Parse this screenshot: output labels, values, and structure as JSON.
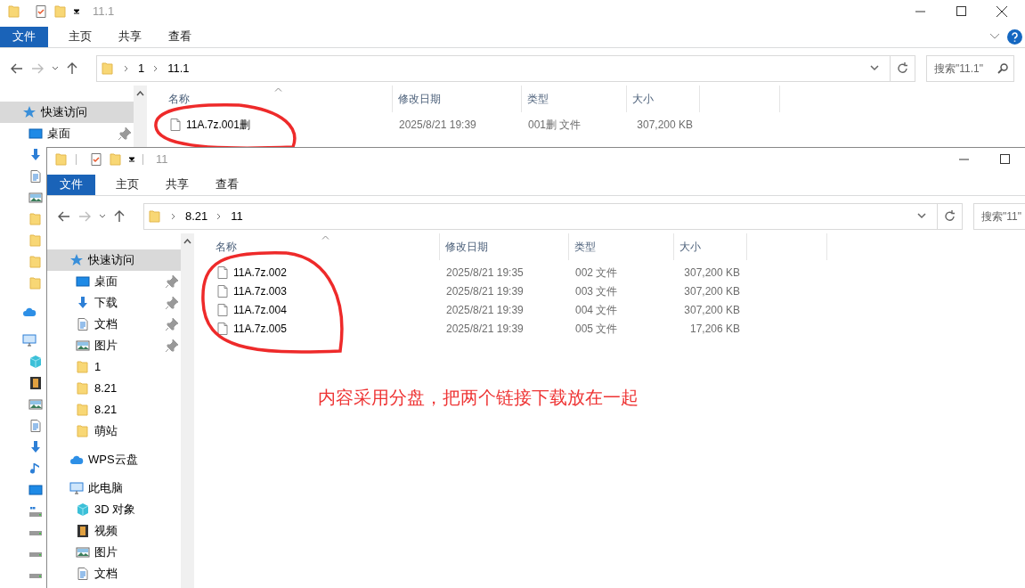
{
  "back_window": {
    "title": "11.1",
    "ribbon_tabs": [
      {
        "label": "文件",
        "kind": "menu"
      },
      {
        "label": "主页",
        "kind": "tab"
      },
      {
        "label": "共享",
        "kind": "tab"
      },
      {
        "label": "查看",
        "kind": "tab"
      }
    ],
    "address": [
      "1",
      "11.1"
    ],
    "search": {
      "placeholder": "搜索\"11.1\"",
      "icon": true
    },
    "nav": [
      {
        "kind": "star",
        "label": "快速访问",
        "selected": true,
        "children": [
          {
            "kind": "desktop",
            "label": "桌面",
            "pinned": true,
            "selected": false
          },
          {
            "kind": "download",
            "selected": false
          },
          {
            "kind": "doc",
            "selected": false
          },
          {
            "kind": "picture",
            "selected": false
          },
          {
            "kind": "folder",
            "selected": false
          },
          {
            "kind": "folder",
            "selected": false
          },
          {
            "kind": "folder",
            "selected": false
          },
          {
            "kind": "folder",
            "selected": false
          }
        ]
      },
      {
        "kind": "cloud",
        "selected": false
      },
      {
        "kind": "pc",
        "selected": false,
        "children": [
          {
            "kind": "cube",
            "selected": false
          },
          {
            "kind": "video",
            "selected": false
          },
          {
            "kind": "picture",
            "selected": false
          },
          {
            "kind": "doc",
            "selected": false
          },
          {
            "kind": "download",
            "selected": false
          },
          {
            "kind": "music",
            "selected": false
          },
          {
            "kind": "desktop",
            "selected": false
          },
          {
            "kind": "windrive",
            "selected": false
          },
          {
            "kind": "drive",
            "selected": false
          },
          {
            "kind": "drive",
            "selected": false
          },
          {
            "kind": "drive",
            "selected": false
          }
        ]
      }
    ],
    "columns": [
      "名称",
      "修改日期",
      "类型",
      "大小"
    ],
    "rows": [
      {
        "name": "11A.7z.001删",
        "date": "2025/8/21 19:39",
        "type": "001删 文件",
        "size": "307,200 KB"
      }
    ]
  },
  "front_window": {
    "title": "11",
    "ribbon_tabs": [
      {
        "label": "文件",
        "kind": "menu"
      },
      {
        "label": "主页",
        "kind": "tab"
      },
      {
        "label": "共享",
        "kind": "tab"
      },
      {
        "label": "查看",
        "kind": "tab"
      }
    ],
    "address": [
      "8.21",
      "11"
    ],
    "search": {
      "placeholder": "搜索\"11\"",
      "icon": false
    },
    "nav": [
      {
        "kind": "star",
        "label": "快速访问",
        "selected": true,
        "children": [
          {
            "kind": "desktop",
            "label": "桌面",
            "pinned": true,
            "selected": false
          },
          {
            "kind": "download",
            "label": "下载",
            "pinned": true,
            "selected": false
          },
          {
            "kind": "doc",
            "label": "文档",
            "pinned": true,
            "selected": false
          },
          {
            "kind": "picture",
            "label": "图片",
            "pinned": true,
            "selected": false
          },
          {
            "kind": "folder",
            "label": "1",
            "pinned": false,
            "selected": false
          },
          {
            "kind": "folder",
            "label": "8.21",
            "pinned": false,
            "selected": false
          },
          {
            "kind": "folder",
            "label": "8.21",
            "pinned": false,
            "selected": false
          },
          {
            "kind": "folder",
            "label": "萌站",
            "pinned": false,
            "selected": false
          }
        ]
      },
      {
        "kind": "cloud",
        "label": "WPS云盘",
        "selected": false
      },
      {
        "kind": "pc",
        "label": "此电脑",
        "selected": false,
        "children": [
          {
            "kind": "cube",
            "label": "3D 对象",
            "selected": false
          },
          {
            "kind": "video",
            "label": "视频",
            "selected": false
          },
          {
            "kind": "picture",
            "label": "图片",
            "selected": false
          },
          {
            "kind": "doc",
            "label": "文档",
            "selected": false
          }
        ]
      }
    ],
    "columns": [
      "名称",
      "修改日期",
      "类型",
      "大小"
    ],
    "rows": [
      {
        "name": "11A.7z.002",
        "date": "2025/8/21 19:35",
        "type": "002 文件",
        "size": "307,200 KB"
      },
      {
        "name": "11A.7z.003",
        "date": "2025/8/21 19:39",
        "type": "003 文件",
        "size": "307,200 KB"
      },
      {
        "name": "11A.7z.004",
        "date": "2025/8/21 19:39",
        "type": "004 文件",
        "size": "307,200 KB"
      },
      {
        "name": "11A.7z.005",
        "date": "2025/8/21 19:39",
        "type": "005 文件",
        "size": "17,206 KB"
      }
    ],
    "annotation": "内容采用分盘，把两个链接下载放在一起"
  }
}
